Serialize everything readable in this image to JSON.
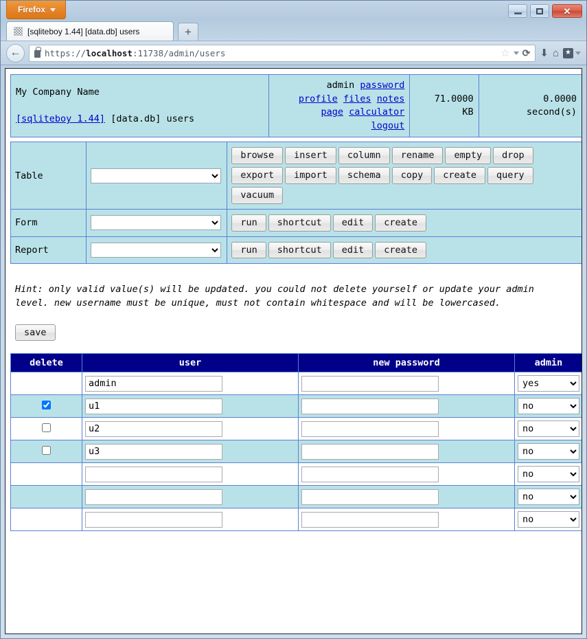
{
  "browser": {
    "app_button": "Firefox",
    "window_controls": {
      "minimize": "minimize-icon",
      "maximize": "maximize-icon",
      "close": "✕"
    },
    "tab": {
      "title": "[sqliteboy 1.44] [data.db] users",
      "favicon": "generic-page-icon"
    },
    "new_tab_label": "+",
    "back_label": "←",
    "url_prefix": "https://",
    "url_host": "localhost",
    "url_rest": ":11738/admin/users",
    "url_full": "https://localhost:11738/admin/users",
    "toolbar_icons": {
      "star": "☆",
      "reload": "⟳",
      "download": "⬇",
      "home": "⌂",
      "bookmarks": "★"
    }
  },
  "page": {
    "info": {
      "company_name": "My Company Name",
      "app_link": "[sqliteboy 1.44]",
      "db_name": "[data.db]",
      "section": "users",
      "links": {
        "user": "admin",
        "password": "password",
        "profile": "profile",
        "files": "files",
        "notes": "notes",
        "page": "page",
        "calculator": "calculator",
        "logout": "logout"
      },
      "size_value": "71.0000",
      "size_unit": "KB",
      "time_value": "0.0000",
      "time_unit": "second(s)"
    },
    "toolbar": {
      "rows": [
        {
          "label": "Table",
          "select_value": "",
          "buttons": [
            "browse",
            "insert",
            "column",
            "rename",
            "empty",
            "drop",
            "export",
            "import",
            "schema",
            "copy",
            "create",
            "query",
            "vacuum"
          ]
        },
        {
          "label": "Form",
          "select_value": "",
          "buttons": [
            "run",
            "shortcut",
            "edit",
            "create"
          ]
        },
        {
          "label": "Report",
          "select_value": "",
          "buttons": [
            "run",
            "shortcut",
            "edit",
            "create"
          ]
        }
      ]
    },
    "hint": "Hint: only valid value(s) will be updated. you could not delete yourself or update your admin level. new username must be unique, must not contain whitespace and will be lowercased.",
    "save_label": "save",
    "users_table": {
      "headers": [
        "delete",
        "user",
        "new password",
        "admin"
      ],
      "rows": [
        {
          "has_checkbox": false,
          "checked": false,
          "user": "admin",
          "password": "",
          "admin": "yes"
        },
        {
          "has_checkbox": true,
          "checked": true,
          "user": "u1",
          "password": "",
          "admin": "no"
        },
        {
          "has_checkbox": true,
          "checked": false,
          "user": "u2",
          "password": "",
          "admin": "no"
        },
        {
          "has_checkbox": true,
          "checked": false,
          "user": "u3",
          "password": "",
          "admin": "no"
        },
        {
          "has_checkbox": false,
          "checked": false,
          "user": "",
          "password": "",
          "admin": "no"
        },
        {
          "has_checkbox": false,
          "checked": false,
          "user": "",
          "password": "",
          "admin": "no"
        },
        {
          "has_checkbox": false,
          "checked": false,
          "user": "",
          "password": "",
          "admin": "no"
        }
      ],
      "admin_options": [
        "yes",
        "no"
      ]
    }
  },
  "colors": {
    "panel_cyan": "#b9e2e8",
    "table_header_navy": "#000089",
    "grid_blue": "#5b7fd4",
    "link_blue": "#0000cc",
    "firefox_orange": "#e8852a"
  }
}
